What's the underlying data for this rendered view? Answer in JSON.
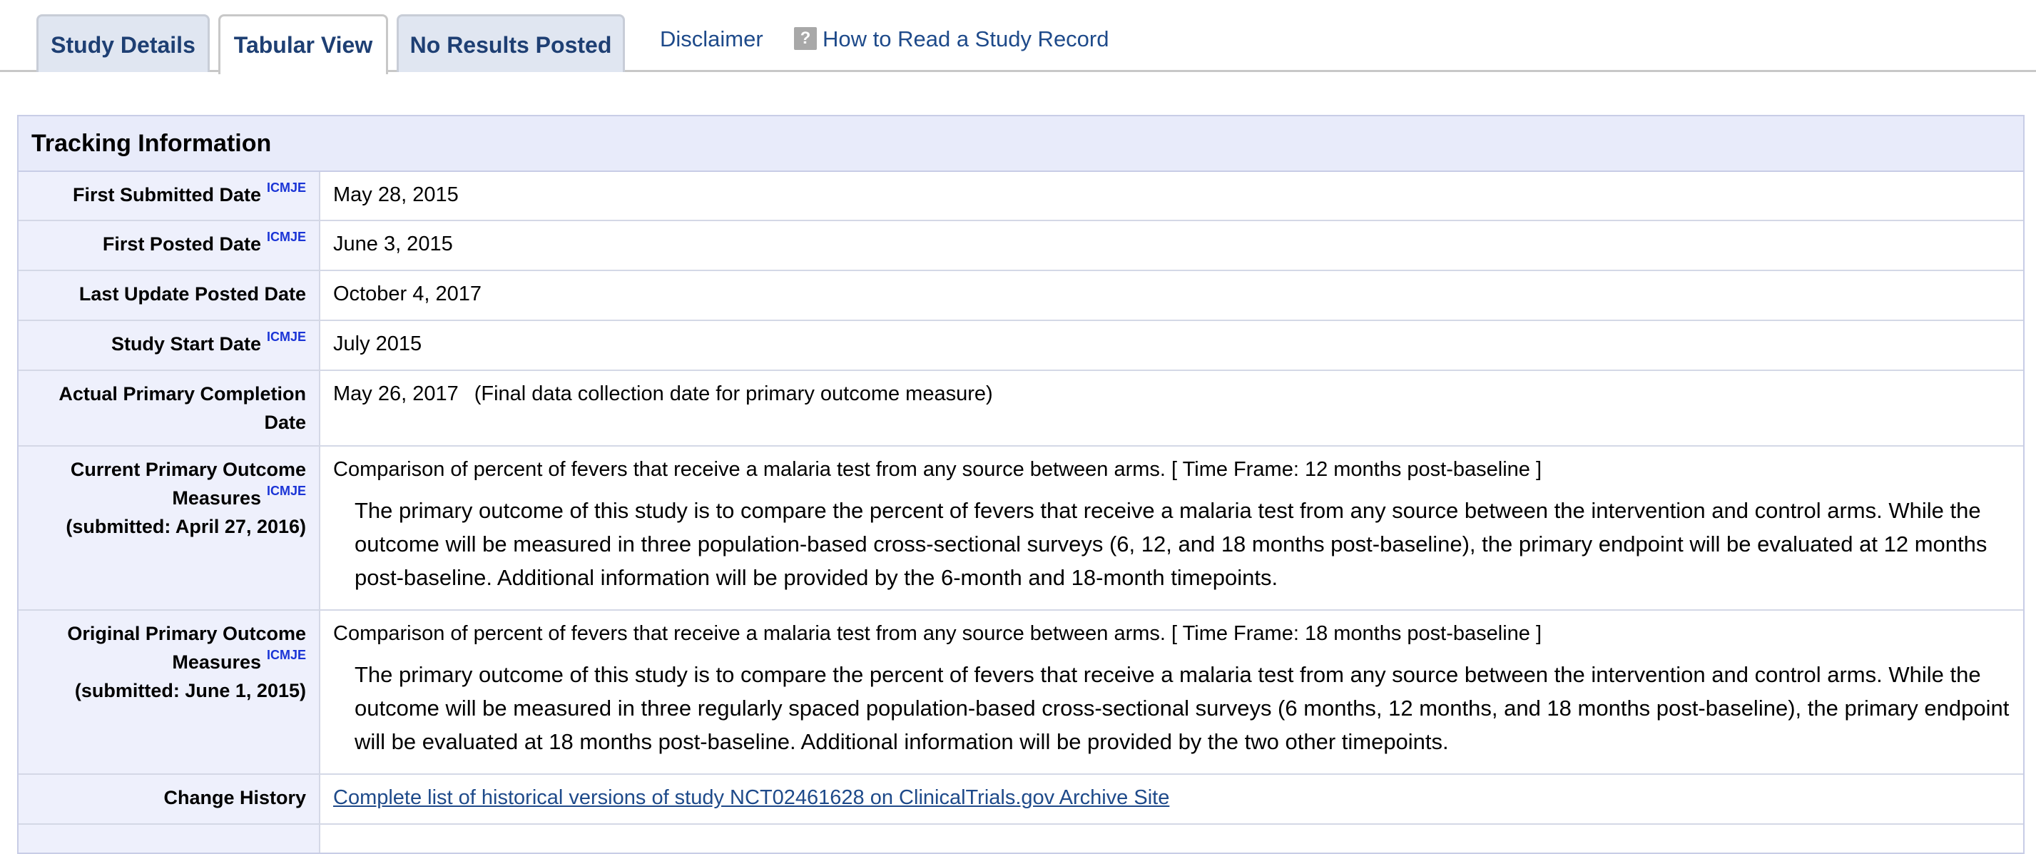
{
  "tabs": [
    {
      "label": "Study Details"
    },
    {
      "label": "Tabular View"
    },
    {
      "label": "No Results Posted"
    }
  ],
  "links": {
    "disclaimer": "Disclaimer",
    "how_to_read": "How to Read a Study Record",
    "help_icon_glyph": "?"
  },
  "panel": {
    "title": "Tracking Information",
    "icmje": "ICMJE",
    "rows": {
      "first_submitted": {
        "label": "First Submitted Date",
        "value": "May 28, 2015"
      },
      "first_posted": {
        "label": "First Posted Date",
        "value": "June 3, 2015"
      },
      "last_update": {
        "label": "Last Update Posted Date",
        "value": "October 4, 2017"
      },
      "study_start": {
        "label": "Study Start Date",
        "value": "July 2015"
      },
      "primary_completion": {
        "label": "Actual Primary Completion Date",
        "value": "May 26, 2017",
        "note": "(Final data collection date for primary outcome measure)"
      },
      "current_primary": {
        "label": "Current Primary Outcome Measures",
        "submitted": "(submitted: April 27, 2016)",
        "measure": "Comparison of percent of fevers that receive a malaria test from any source between arms. [ Time Frame: 12 months post-baseline ]",
        "description": "The primary outcome of this study is to compare the percent of fevers that receive a malaria test from any source between the intervention and control arms. While the outcome will be measured in three population-based cross-sectional surveys (6, 12, and 18 months post-baseline), the primary endpoint will be evaluated at 12 months post-baseline. Additional information will be provided by the 6-month and 18-month timepoints."
      },
      "original_primary": {
        "label": "Original Primary Outcome Measures",
        "submitted": "(submitted: June 1, 2015)",
        "measure": "Comparison of percent of fevers that receive a malaria test from any source between arms. [ Time Frame: 18 months post-baseline ]",
        "description": "The primary outcome of this study is to compare the percent of fevers that receive a malaria test from any source between the intervention and control arms. While the outcome will be measured in three regularly spaced population-based cross-sectional surveys (6 months, 12 months, and 18 months post-baseline), the primary endpoint will be evaluated at 18 months post-baseline. Additional information will be provided by the two other timepoints."
      },
      "change_history": {
        "label": "Change History",
        "link": "Complete list of historical versions of study NCT02461628 on ClinicalTrials.gov Archive Site"
      }
    }
  },
  "colors": {
    "tab_bg": "#e0e6f1",
    "tab_text": "#1e3f73",
    "link": "#1e4a8a",
    "label_bg": "#eef0fc",
    "header_bg": "#e8ebfa",
    "icmje": "#1a34d6"
  }
}
